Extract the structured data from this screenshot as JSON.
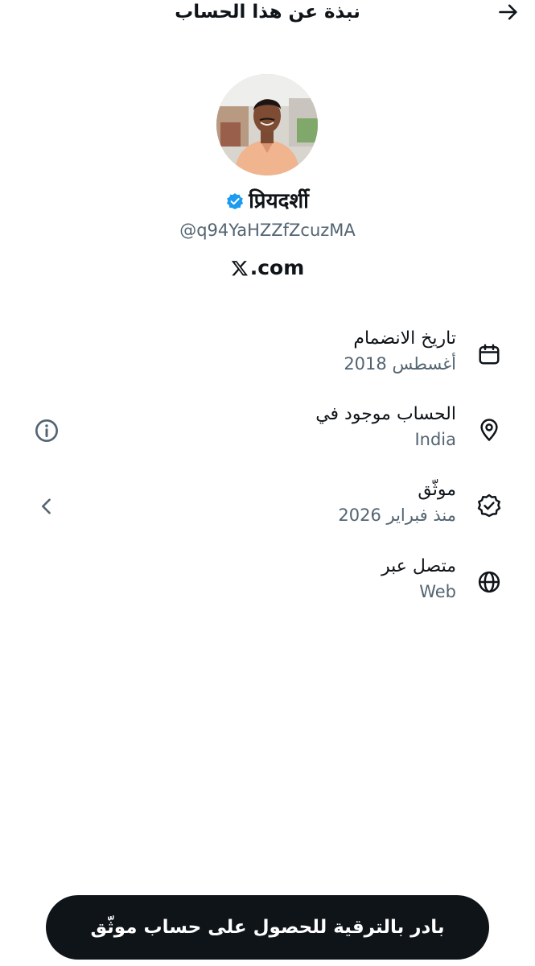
{
  "header": {
    "title": "نبذة عن هذا الحساب",
    "back_icon": "arrow-right-icon"
  },
  "profile": {
    "avatar_icon": "avatar",
    "display_name": "प्रियदर्शी",
    "verified_icon": "verified-badge-icon",
    "handle": "@q94YaHZZfZcuzMA",
    "site": ".com",
    "site_logo": "x-logo-icon"
  },
  "info": [
    {
      "label": "تاريخ الانضمام",
      "value": "أغسطس 2018",
      "icon": "calendar-icon"
    },
    {
      "label": "الحساب موجود في",
      "value": "India",
      "icon": "location-pin-icon",
      "side_icon": "info-icon"
    },
    {
      "label": "موثّق",
      "value": "منذ فبراير 2026",
      "icon": "verified-outline-icon",
      "side_icon": "chevron-left-icon"
    },
    {
      "label": "متصل عبر",
      "value": "Web",
      "icon": "globe-icon"
    }
  ],
  "upgrade_button": {
    "label": "بادر بالترقية للحصول على حساب موثّق"
  },
  "colors": {
    "text_primary": "#0f1419",
    "text_secondary": "#536471",
    "verified_blue": "#1d9bf0",
    "button_bg": "#0f1419"
  }
}
